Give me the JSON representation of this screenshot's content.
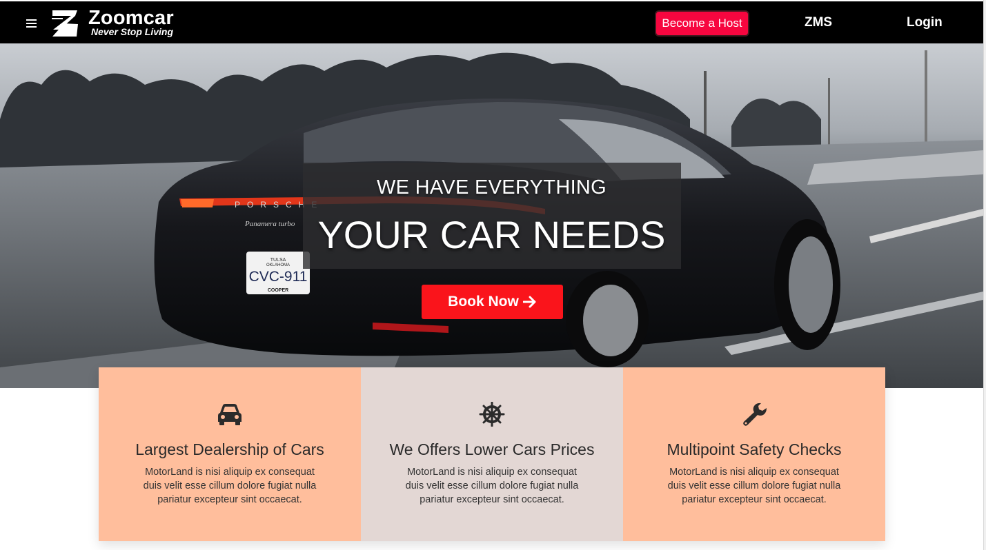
{
  "navbar": {
    "menu_icon": "hamburger-menu-icon",
    "brand": {
      "name": "Zoomcar",
      "tagline": "Never Stop Living",
      "logo_icon": "zoomcar-logo-icon"
    },
    "become_host_label": "Become a Host",
    "zms_label": "ZMS",
    "login_label": "Login",
    "colors": {
      "background": "#000000",
      "host_button": "#f7063f"
    }
  },
  "hero": {
    "subtitle": "WE HAVE EVERYTHING",
    "title": "YOUR CAR NEEDS",
    "book_button_label": "Book Now",
    "book_button_icon": "arrow-right-icon",
    "book_button_color": "#fa141b",
    "background_image": "black porsche panamera turbo driving on highway",
    "car_badge": "PORSCHE",
    "car_model": "Panamera turbo",
    "license_plate": {
      "state": "OKLAHOMA",
      "city": "TULSA",
      "number": "CVC-911",
      "bottom": "COOPER"
    }
  },
  "features": [
    {
      "icon": "car-icon",
      "title": "Largest Dealership of Cars",
      "description": "MotorLand is nisi aliquip ex consequat duis velit esse cillum dolore fugiat nulla pariatur excepteur sint occaecat.",
      "background": "#ffbe9c"
    },
    {
      "icon": "ship-wheel-icon",
      "title": "We Offers Lower Cars Prices",
      "description": "MotorLand is nisi aliquip ex consequat duis velit esse cillum dolore fugiat nulla pariatur excepteur sint occaecat.",
      "background": "#e3d7d4"
    },
    {
      "icon": "wrench-icon",
      "title": "Multipoint Safety Checks",
      "description": "MotorLand is nisi aliquip ex consequat duis velit esse cillum dolore fugiat nulla pariatur excepteur sint occaecat.",
      "background": "#ffbe9c"
    }
  ]
}
